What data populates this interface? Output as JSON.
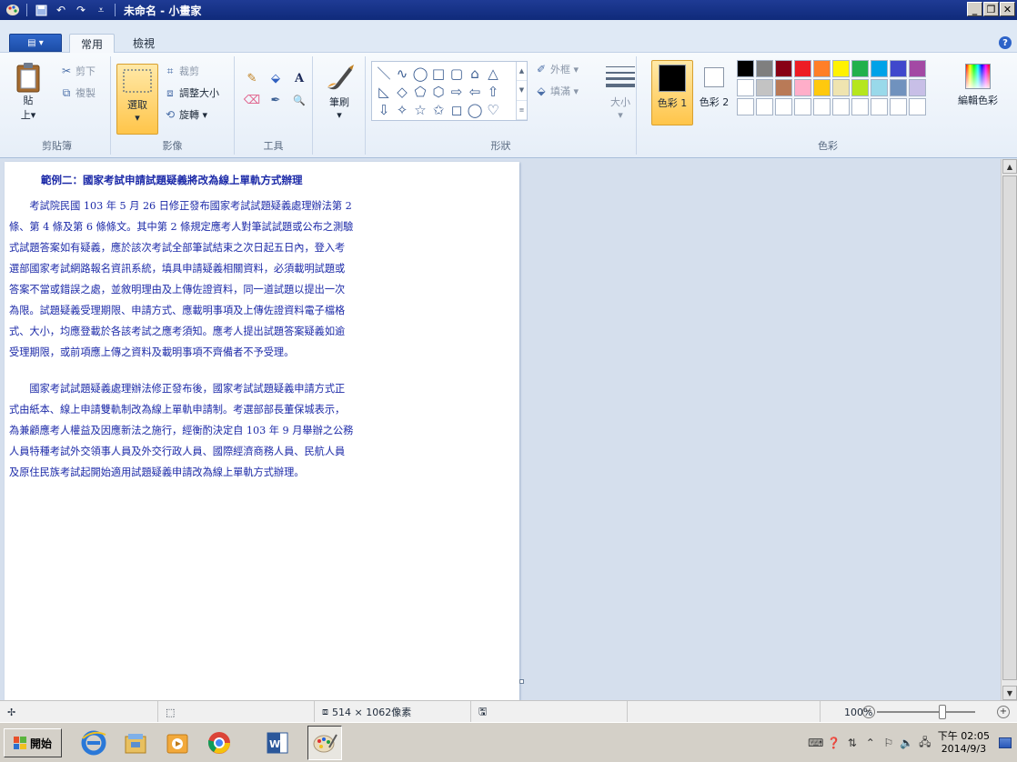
{
  "window": {
    "title": "未命名 - 小畫家",
    "controls": [
      "_",
      "❐",
      "✕"
    ]
  },
  "ribbon_tabs": {
    "file_label": "▤ ▾",
    "tabs": [
      "常用",
      "檢視"
    ],
    "active": "常用"
  },
  "clipboard": {
    "paste": "貼",
    "paste_sub": "上▾",
    "cut": "剪下",
    "copy": "複製",
    "label": "剪貼簿"
  },
  "image_group": {
    "select": "選取",
    "select_sub": "▾",
    "crop": "裁剪",
    "resize": "調整大小",
    "rotate": "旋轉 ▾",
    "label": "影像"
  },
  "tools": {
    "label": "工具",
    "items": [
      "✎",
      "⬙",
      "A",
      "⌫",
      "✒",
      "🔍"
    ]
  },
  "brushes": {
    "label": "筆刷",
    "sub": "▾"
  },
  "shapes": {
    "label": "形狀",
    "outline": "外框 ▾",
    "fill": "填滿 ▾",
    "items": [
      "＼",
      "∿",
      "◯",
      "□",
      "▢",
      "⌂",
      "△",
      "◺",
      "◇",
      "⬠",
      "⬡",
      "⇨",
      "⇦",
      "⇧",
      "⇩",
      "✧",
      "☆",
      "✩",
      "◻",
      "◯",
      "♡"
    ]
  },
  "size": {
    "label": "大小",
    "sub": "▾"
  },
  "colors": {
    "label": "色彩",
    "color1": "色彩 1",
    "color2": "色彩 2",
    "color1_value": "#000000",
    "color2_value": "#ffffff",
    "palette": [
      "#000000",
      "#7f7f7f",
      "#880015",
      "#ed1c24",
      "#ff7f27",
      "#fff200",
      "#22b14c",
      "#00a2e8",
      "#3f48cc",
      "#a349a4",
      "#ffffff",
      "#c3c3c3",
      "#b97a57",
      "#ffaec9",
      "#ffc90e",
      "#efe4b0",
      "#b5e61d",
      "#99d9ea",
      "#7092be",
      "#c8bfe7",
      "#ffffff",
      "#ffffff",
      "#ffffff",
      "#ffffff",
      "#ffffff",
      "#ffffff",
      "#ffffff",
      "#ffffff",
      "#ffffff",
      "#ffffff"
    ],
    "edit": "編輯色彩"
  },
  "document": {
    "title": "範例二：國家考試申請試題疑義將改為線上單軌方式辦理",
    "paragraph1": [
      "　　考試院民國 103 年 5 月 26 日修正發布國家考試試題疑義處理辦法第 2",
      "條、第 4 條及第 6 條條文。其中第 2 條規定應考人對筆試試題或公布之測驗",
      "式試題答案如有疑義，應於該次考試全部筆試結束之次日起五日內，登入考",
      "選部國家考試網路報名資訊系統，填具申請疑義相關資料，必須載明試題或",
      "答案不當或錯誤之處，並敘明理由及上傳佐證資料，同一道試題以提出一次",
      "為限。試題疑義受理期限、申請方式、應載明事項及上傳佐證資料電子檔格",
      "式、大小，均應登載於各該考試之應考須知。應考人提出試題答案疑義如逾",
      "受理期限，或前項應上傳之資料及載明事項不齊備者不予受理。"
    ],
    "paragraph2": [
      "　　國家考試試題疑義處理辦法修正發布後，國家考試試題疑義申請方式正",
      "式由紙本、線上申請雙軌制改為線上單軌申請制。考選部部長董保城表示，",
      "為兼顧應考人權益及因應新法之施行，經衡酌決定自 103 年 9 月舉辦之公務",
      "人員特種考試外交領事人員及外交行政人員、國際經濟商務人員、民航人員",
      "及原住民族考試起開始適用試題疑義申請改為線上單軌方式辦理。"
    ]
  },
  "statusbar": {
    "move_icon": "✢",
    "select_icon": "⬚",
    "size_text": "514 × 1062像素",
    "disk_icon": "🖫",
    "zoom": "100%",
    "zoom_level": 0.5
  },
  "taskbar": {
    "start": "開始",
    "clock_time": "下午 02:05",
    "clock_date": "2014/9/3"
  }
}
